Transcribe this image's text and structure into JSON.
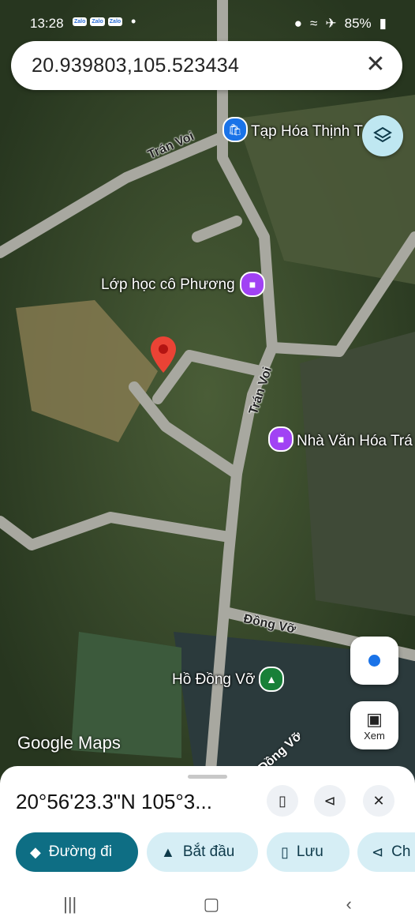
{
  "status_bar": {
    "time": "13:28",
    "apps": [
      "Zalo",
      "Zalo",
      "Zalo"
    ],
    "battery": "85%"
  },
  "search": {
    "query": "20.939803,105.523434"
  },
  "map": {
    "places": [
      {
        "name": "Tạp Hóa Thịnh T",
        "icon": "shopping-bag-icon",
        "color": "#1a73e8"
      },
      {
        "name": "Lớp học cô Phương",
        "icon": "school-icon",
        "color": "#a142f4"
      },
      {
        "name": "Nhà Văn Hóa Trá",
        "icon": "community-hall-icon",
        "color": "#a142f4"
      },
      {
        "name": "Hồ Đồng Vỡ",
        "icon": "tree-icon",
        "color": "#188038"
      }
    ],
    "roads": [
      "Trán Voi",
      "Trán Voi",
      "Đồng Vỡ",
      "Đồng Vỡ"
    ],
    "watermark": "Google Maps",
    "scan_label": "Xem"
  },
  "sheet": {
    "coordinates": "20°56'23.3\"N 105°3...",
    "actions": [
      {
        "label": "Đường đi",
        "icon": "directions-icon"
      },
      {
        "label": "Bắt đầu",
        "icon": "navigation-arrow-icon"
      },
      {
        "label": "Lưu",
        "icon": "bookmark-icon"
      },
      {
        "label": "Ch",
        "icon": "share-icon"
      }
    ]
  },
  "colors": {
    "accent": "#0e6e84",
    "chip": "#d6eef5",
    "pin": "#ea4335"
  }
}
